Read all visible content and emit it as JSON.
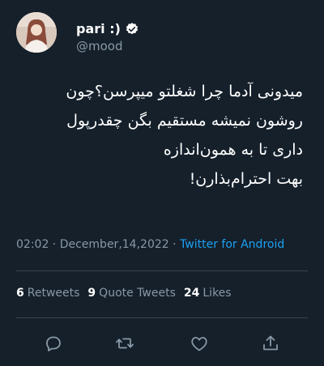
{
  "user": {
    "name": "pari :)",
    "handle": "@mood"
  },
  "tweet": {
    "lines": [
      "میدونی آدما چرا شغلتو میپرسن؟چون",
      "روشون نمیشه مستقیم بگن چقدرپول",
      "داری تا به همون‌اندازه",
      "بهت احترام‌بذارن!"
    ],
    "time": "02:02",
    "separator": " · ",
    "date": "December,14,2022",
    "source": "Twitter for Android"
  },
  "stats": {
    "retweets": {
      "count": "6",
      "label": "Retweets"
    },
    "quotes": {
      "count": "9",
      "label": "Quote Tweets"
    },
    "likes": {
      "count": "24",
      "label": "Likes"
    }
  },
  "icons": {
    "reply": "reply-icon",
    "retweet": "retweet-icon",
    "like": "like-icon",
    "share": "share-icon",
    "verified": "verified-badge-icon"
  },
  "colors": {
    "background": "#15202b",
    "muted": "#8899a6",
    "accent": "#1da1f2",
    "divider": "#38444d"
  }
}
